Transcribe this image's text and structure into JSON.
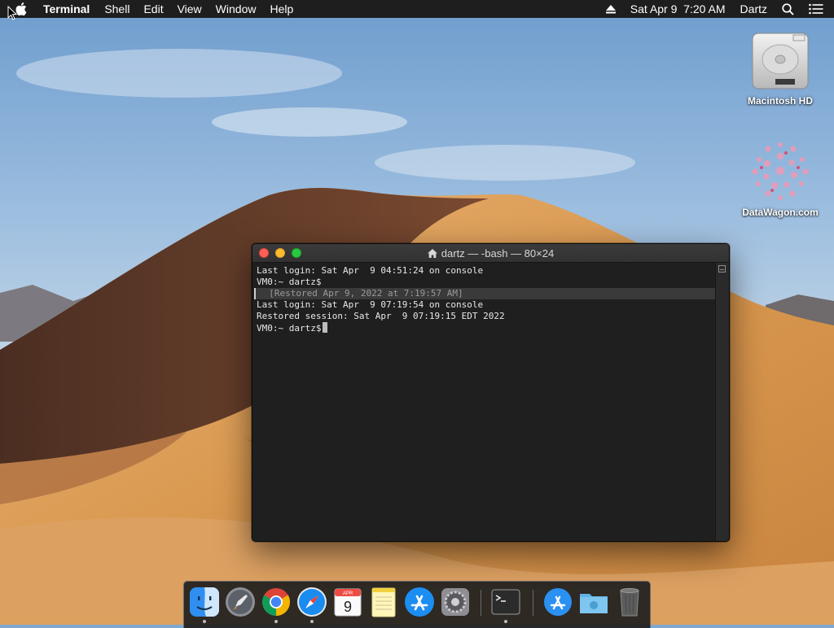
{
  "menubar": {
    "apple_icon": "apple-icon",
    "app_name": "Terminal",
    "items": [
      "Shell",
      "Edit",
      "View",
      "Window",
      "Help"
    ],
    "eject_icon": "eject-icon",
    "datetime": "Sat Apr 9  7:20 AM",
    "user": "Dartz",
    "search_icon": "search-icon",
    "notification_icon": "list-icon"
  },
  "desktop": {
    "icons": [
      {
        "label": "Macintosh HD",
        "icon": "hard-drive-icon"
      },
      {
        "label": "DataWagon.com",
        "icon": "datawagon-logo-icon"
      }
    ]
  },
  "terminal": {
    "title": "dartz — -bash — 80×24",
    "lines": [
      "Last login: Sat Apr  9 04:51:24 on console",
      "VM0:~ dartz$",
      "  [Restored Apr 9, 2022 at 7:19:57 AM]",
      "Last login: Sat Apr  9 07:19:54 on console",
      "Restored session: Sat Apr  9 07:19:15 EDT 2022",
      "VM0:~ dartz$"
    ]
  },
  "dock": {
    "items": [
      {
        "name": "Finder",
        "icon": "finder-icon",
        "running": true
      },
      {
        "name": "Launchpad",
        "icon": "launchpad-icon",
        "running": false
      },
      {
        "name": "Google Chrome",
        "icon": "chrome-icon",
        "running": true
      },
      {
        "name": "Safari",
        "icon": "safari-icon",
        "running": true
      },
      {
        "name": "Calendar",
        "icon": "calendar-icon",
        "running": false,
        "month": "APR",
        "day": "9"
      },
      {
        "name": "Notes",
        "icon": "notes-icon",
        "running": false
      },
      {
        "name": "App Store",
        "icon": "app-store-icon",
        "running": false
      },
      {
        "name": "System Preferences",
        "icon": "system-preferences-icon",
        "running": false
      },
      {
        "name": "Terminal",
        "icon": "terminal-icon",
        "running": true
      },
      {
        "name": "Applications",
        "icon": "applications-folder-icon",
        "running": false
      },
      {
        "name": "Downloads",
        "icon": "downloads-folder-icon",
        "running": false
      },
      {
        "name": "Trash",
        "icon": "trash-icon",
        "running": false
      }
    ]
  },
  "colors": {
    "menubar_bg": "#1e1e1e",
    "terminal_bg": "#1f1f1f",
    "close": "#fe5f57",
    "minimize": "#febc2e",
    "maximize": "#28c840"
  }
}
